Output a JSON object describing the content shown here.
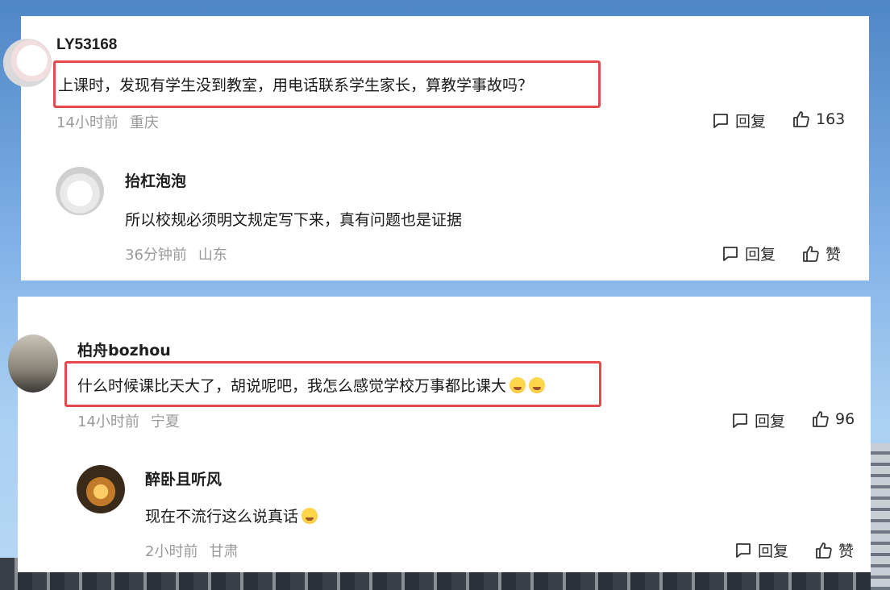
{
  "threads": [
    {
      "main": {
        "username": "LY53168",
        "text": "上课时，发现有学生没到教室，用电话联系学生家长，算教学事故吗？",
        "time": "14小时前",
        "location": "重庆",
        "reply_label": "回复",
        "like_count": "163"
      },
      "reply": {
        "username": "抬杠泡泡",
        "text": "所以校规必须明文规定写下来，真有问题也是证据",
        "time": "36分钟前",
        "location": "山东",
        "reply_label": "回复",
        "like_label": "赞"
      }
    },
    {
      "main": {
        "username": "柏舟bozhou",
        "text": "什么时候课比天大了，胡说呢吧，我怎么感觉学校万事都比课大",
        "time": "14小时前",
        "location": "宁夏",
        "reply_label": "回复",
        "like_count": "96"
      },
      "reply": {
        "username": "醉卧且听风",
        "text": "现在不流行这么说真话",
        "time": "2小时前",
        "location": "甘肃",
        "reply_label": "回复",
        "like_label": "赞"
      }
    }
  ],
  "icons": {
    "comment": "comment-bubble-icon",
    "like": "thumbs-up-icon",
    "emoji": "laughing-crying-emoji-icon"
  },
  "colors": {
    "highlight_border": "#e5484d",
    "meta_text": "#9a9a9a",
    "card_bg": "#ffffff"
  }
}
